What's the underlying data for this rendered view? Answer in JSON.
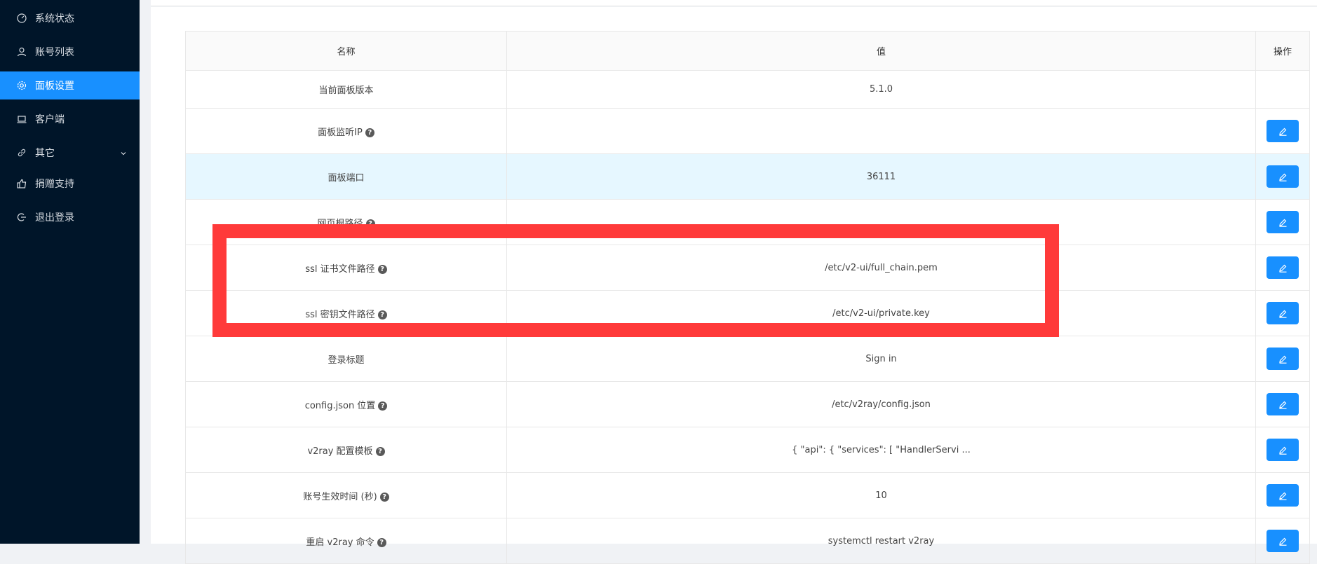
{
  "sidebar": {
    "items": [
      {
        "label": "系统状态",
        "icon": "dashboard-icon",
        "active": false
      },
      {
        "label": "账号列表",
        "icon": "user-icon",
        "active": false
      },
      {
        "label": "面板设置",
        "icon": "gear-icon",
        "active": true
      },
      {
        "label": "客户端",
        "icon": "laptop-icon",
        "active": false
      },
      {
        "label": "其它",
        "icon": "link-icon",
        "active": false,
        "has_submenu": true
      },
      {
        "label": "捐赠支持",
        "icon": "thumbs-up-icon",
        "active": false
      },
      {
        "label": "退出登录",
        "icon": "logout-icon",
        "active": false
      }
    ]
  },
  "table": {
    "headers": {
      "name": "名称",
      "value": "值",
      "action": "操作"
    },
    "rows": [
      {
        "name": "当前面板版本",
        "value": "5.1.0",
        "help": false,
        "editable": false
      },
      {
        "name": "面板监听IP",
        "value": "",
        "help": true,
        "editable": true
      },
      {
        "name": "面板端口",
        "value": "36111",
        "help": false,
        "editable": true
      },
      {
        "name": "网页根路径",
        "value": "",
        "help": true,
        "editable": true
      },
      {
        "name": "ssl 证书文件路径",
        "value": "/etc/v2-ui/full_chain.pem",
        "help": true,
        "editable": true
      },
      {
        "name": "ssl 密钥文件路径",
        "value": "/etc/v2-ui/private.key",
        "help": true,
        "editable": true
      },
      {
        "name": "登录标题",
        "value": "Sign in",
        "help": false,
        "editable": true
      },
      {
        "name": "config.json 位置",
        "value": "/etc/v2ray/config.json",
        "help": true,
        "editable": true
      },
      {
        "name": "v2ray 配置模板",
        "value": "{ \"api\": { \"services\": [ \"HandlerServi ...",
        "help": true,
        "editable": true
      },
      {
        "name": "账号生效时间 (秒)",
        "value": "10",
        "help": true,
        "editable": true
      },
      {
        "name": "重启 v2ray 命令",
        "value": "systemctl restart v2ray",
        "help": true,
        "editable": true
      }
    ]
  },
  "colors": {
    "sidebar_bg": "#001529",
    "active_bg": "#1890ff",
    "highlight_row": "#e6f7ff",
    "annotation": "#ff3a3a"
  }
}
